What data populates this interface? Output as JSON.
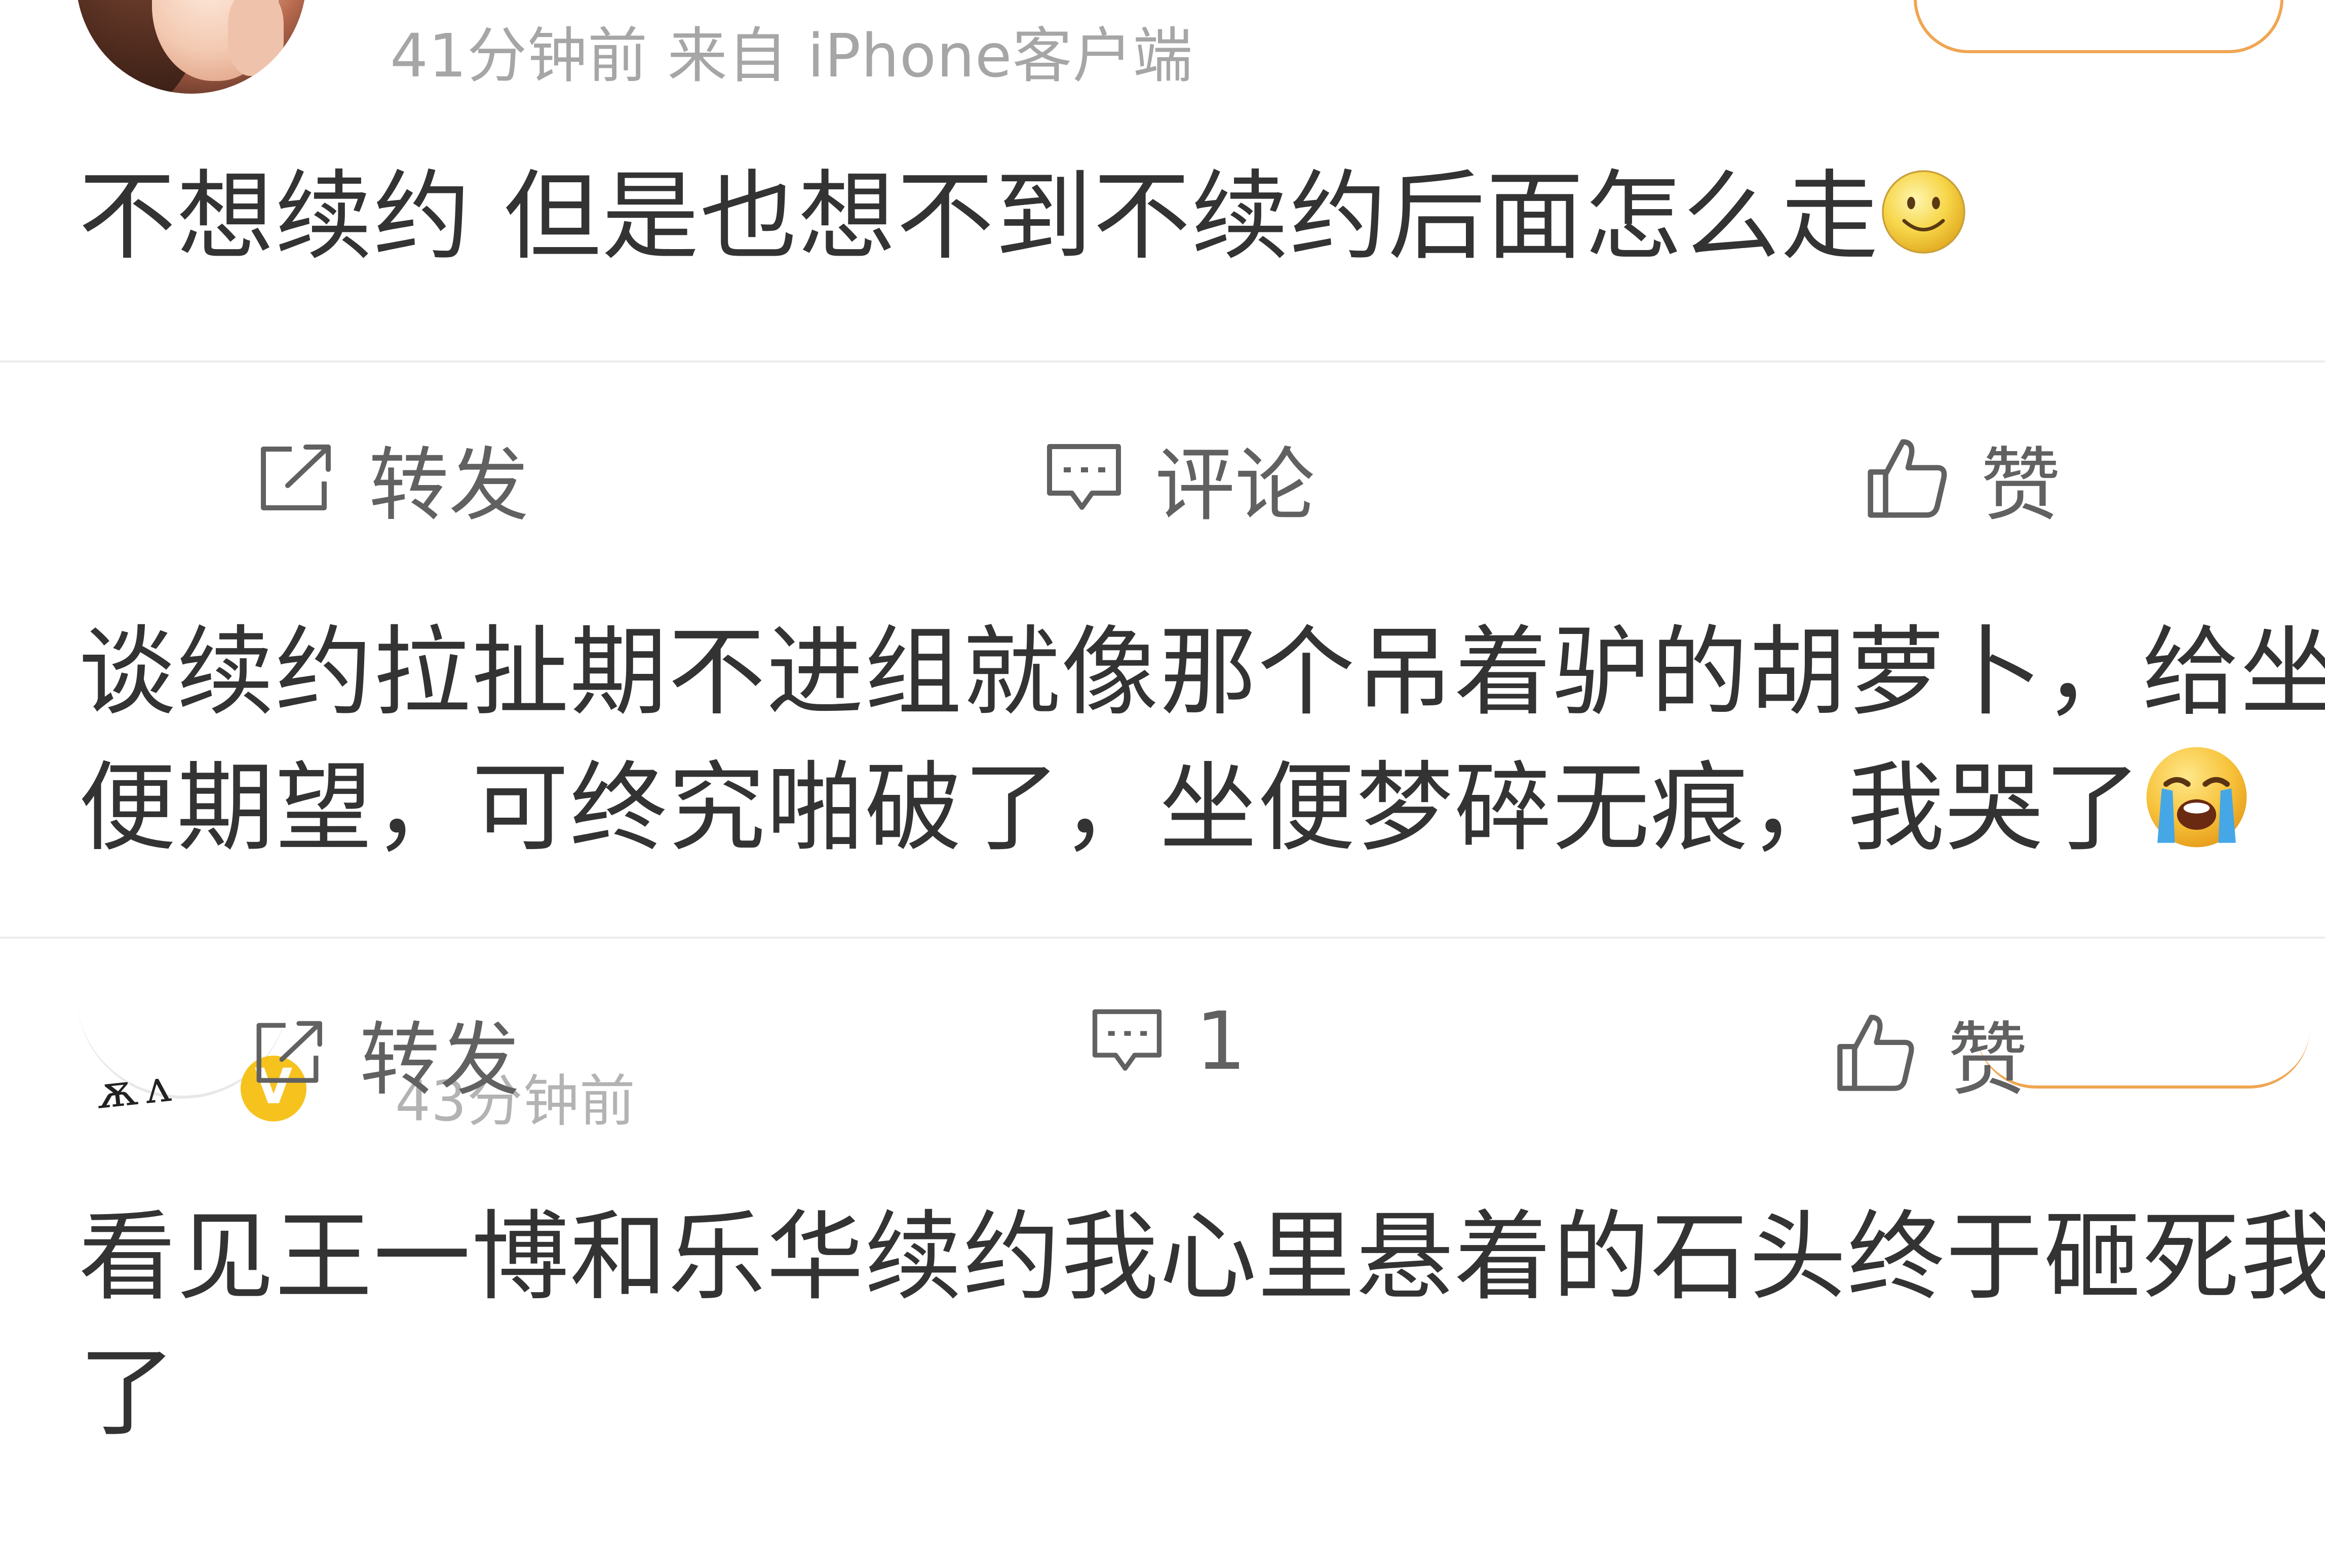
{
  "posts": [
    {
      "meta": "41分钟前  来自 iPhone客户端",
      "text": "不想续约 但是也想不到不续约后面怎么走",
      "emoji": "smile-emoji"
    },
    {
      "text_line1": "谈续约拉扯期不进组就像那个吊着驴的胡萝卜，给坐",
      "text_line2": "便期望，可终究啪破了，坐便梦碎无痕，我哭了",
      "emoji": "crying-emoji"
    },
    {
      "meta": "43分钟前",
      "verified_badge": "V",
      "text_line1": "看见王一博和乐华续约我心里悬着的石头终于砸死我",
      "text_line2": "了"
    }
  ],
  "actions_post1": {
    "forward": "转发",
    "comment": "评论",
    "like": "赞"
  },
  "actions_post2": {
    "forward": "转发",
    "comment": "1",
    "like": "赞"
  },
  "icons": [
    "forward-icon",
    "comment-icon",
    "thumbs-up-icon"
  ],
  "colors": {
    "background": "#ffffff",
    "text": "#333333",
    "meta": "#a6a6a6",
    "action": "#616161",
    "follow_border": "#f0a552",
    "divider": "#ececec",
    "verified": "#f6c21e"
  }
}
